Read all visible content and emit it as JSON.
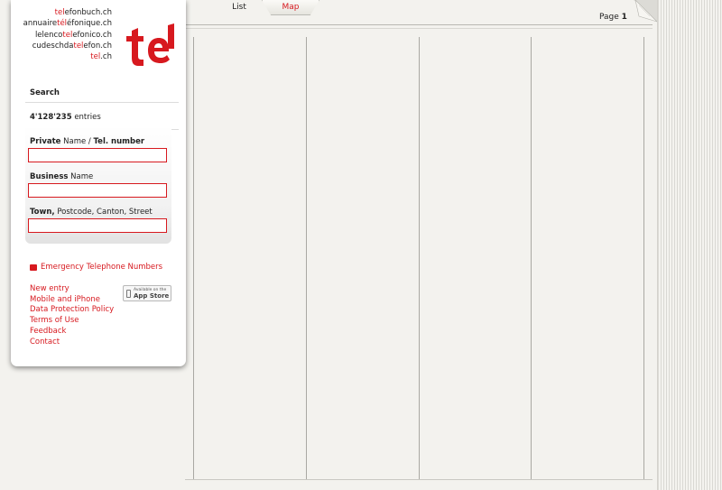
{
  "brand": {
    "sites": [
      {
        "red": "tel",
        "rest": "efonbuch.ch"
      },
      {
        "pre": "annuaire",
        "red": "tél",
        "rest": "éfonique.ch"
      },
      {
        "pre": "lelenco",
        "red": "tel",
        "rest": "efonico.ch"
      },
      {
        "pre": "cudeschda",
        "red": "tel",
        "rest": "efon.ch"
      },
      {
        "red": "tel",
        "rest": ".ch"
      }
    ],
    "logo_text": "tel",
    "accent_color": "#d7191f"
  },
  "search": {
    "title": "Search",
    "entries_count": "4'128'235",
    "entries_label": "entries",
    "private_label_bold": "Private",
    "private_label_mid": "Name /",
    "private_label_bold2": "Tel. number",
    "private_value": "",
    "business_label_bold": "Business",
    "business_label_rest": "Name",
    "business_value": "",
    "town_label_bold": "Town,",
    "town_label_rest": "Postcode, Canton, Street",
    "town_value": ""
  },
  "emergency_link": "Emergency Telephone Numbers",
  "footer_links": [
    "New entry",
    "Mobile and iPhone",
    "Data Protection Policy",
    "Terms of Use",
    "Feedback",
    "Contact"
  ],
  "appstore": {
    "line1": "Available on the",
    "line2": "App Store",
    "icon": "phone-icon"
  },
  "tabs": {
    "list": "List",
    "map": "Map"
  },
  "pagination": {
    "label": "Page",
    "number": "1"
  },
  "icons": {
    "page_curl": "page-curl-icon"
  }
}
